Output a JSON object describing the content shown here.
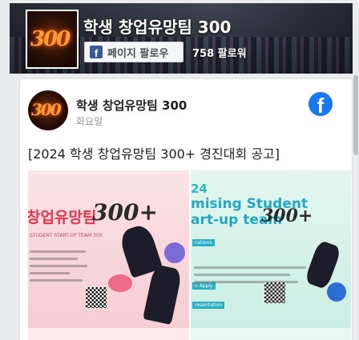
{
  "header": {
    "page_name": "학생 창업유망팀 300",
    "follow_label": "페이지 팔로우",
    "followers_text": "758 팔로워",
    "profile_logo_text": "300"
  },
  "post": {
    "author": "학생 창업유망팀 300",
    "time": "화요일",
    "text": "[2024 학생 창업유망팀 300+ 경진대회 공고]",
    "avatar_logo_text": "300",
    "images": [
      {
        "title": "창업유망팀",
        "title_num": "300+",
        "subtitle": "STUDENT START-UP TEAM 300"
      },
      {
        "year": "24",
        "title_line1": "mising Student",
        "title_line2": "art-up team",
        "title_num": "300+",
        "sections": [
          "cations",
          "o Apply",
          "resentation"
        ]
      }
    ]
  },
  "icons": {
    "facebook_logo": "facebook-icon",
    "facebook_square": "facebook-square-icon"
  },
  "colors": {
    "facebook_blue": "#1877f2",
    "follow_icon_blue": "#3b5998",
    "text_primary": "#1c1e21",
    "text_secondary": "#90949c"
  }
}
